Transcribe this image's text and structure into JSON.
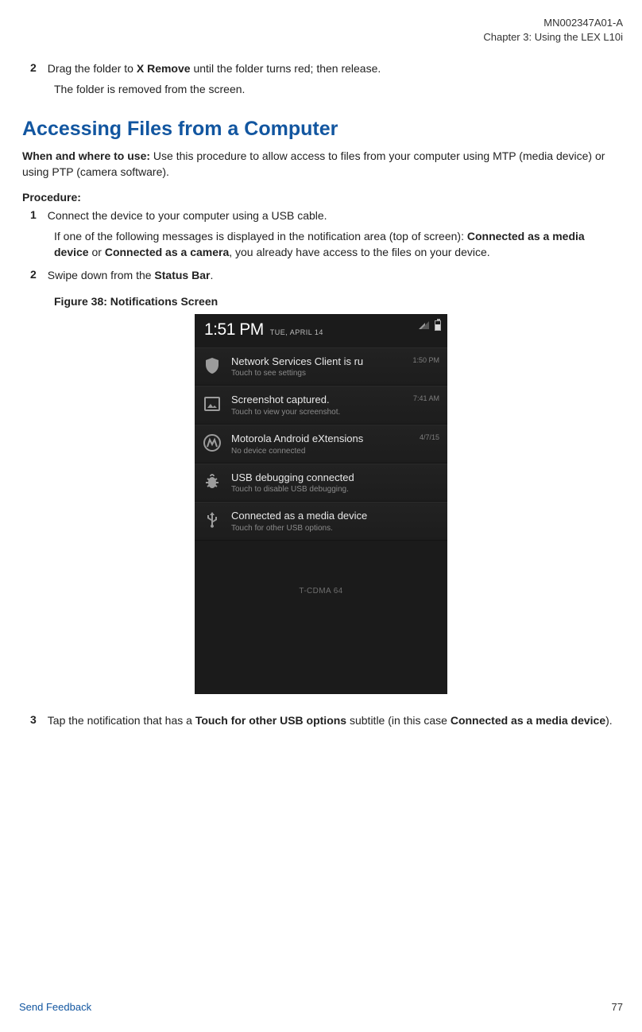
{
  "header": {
    "doc_id": "MN002347A01-A",
    "chapter": "Chapter 3:  Using the LEX L10i"
  },
  "intro_step": {
    "num": "2",
    "text_pre": "Drag the folder to ",
    "text_bold": "X Remove",
    "text_post": " until the folder turns red; then release.",
    "followup": "The folder is removed from the screen."
  },
  "section_title": "Accessing Files from a Computer",
  "when_label": "When and where to use: ",
  "when_text": "Use this procedure to allow access to files from your computer using MTP (media device) or using PTP (camera software).",
  "procedure_label": "Procedure:",
  "steps": [
    {
      "num": "1",
      "text": "Connect the device to your computer using a USB cable.",
      "followup_parts": [
        {
          "t": "If one of the following messages is displayed in the notification area (top of screen): "
        },
        {
          "t": "Connected as a media device",
          "b": true
        },
        {
          "t": " or "
        },
        {
          "t": "Connected as a camera",
          "b": true
        },
        {
          "t": ", you already have access to the files on your device."
        }
      ]
    },
    {
      "num": "2",
      "parts": [
        {
          "t": "Swipe down from the "
        },
        {
          "t": "Status Bar",
          "b": true
        },
        {
          "t": "."
        }
      ]
    }
  ],
  "figure_caption": "Figure 38: Notifications Screen",
  "phone": {
    "time": "1:51 PM",
    "date": "TUE, APRIL 14",
    "rows": [
      {
        "icon": "shield",
        "title": "Network Services Client is ru",
        "sub": "Touch to see settings",
        "ts": "1:50 PM"
      },
      {
        "icon": "image",
        "title": "Screenshot captured.",
        "sub": "Touch to view your screenshot.",
        "ts": "7:41 AM"
      },
      {
        "icon": "moto",
        "title": "Motorola Android eXtensions",
        "sub": "No device connected",
        "ts": "4/7/15"
      },
      {
        "icon": "bug",
        "title": "USB debugging connected",
        "sub": "Touch to disable USB debugging.",
        "ts": ""
      },
      {
        "icon": "usb",
        "title": "Connected as a media device",
        "sub": "Touch for other USB options.",
        "ts": ""
      }
    ],
    "carrier": "T-CDMA 64"
  },
  "step3": {
    "num": "3",
    "parts": [
      {
        "t": "Tap the notification that has a "
      },
      {
        "t": "Touch for other USB options",
        "b": true
      },
      {
        "t": " subtitle (in this case "
      },
      {
        "t": "Connected as a media device",
        "b": true
      },
      {
        "t": ")."
      }
    ]
  },
  "footer": {
    "feedback": "Send Feedback",
    "page": "77"
  }
}
